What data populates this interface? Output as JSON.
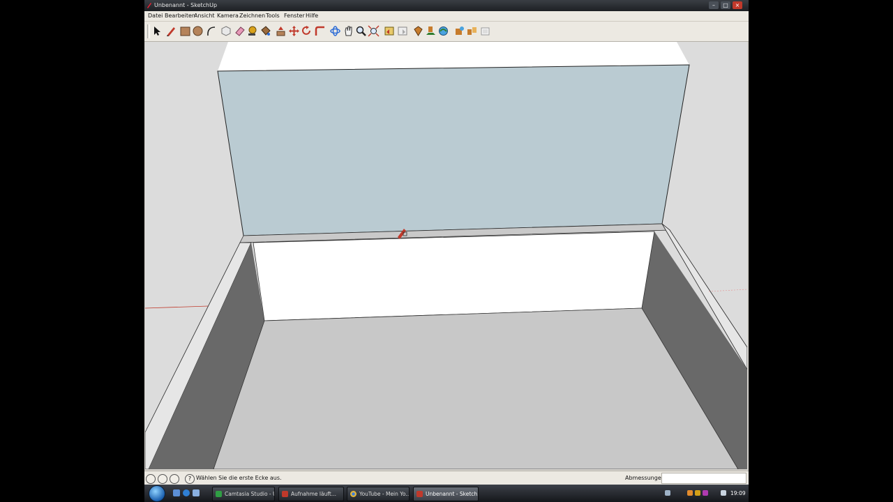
{
  "window": {
    "title": "Unbenannt - SketchUp",
    "controls": [
      "minimize-icon",
      "maximize-icon",
      "close-icon"
    ]
  },
  "menu": [
    "Datei",
    "Bearbeiten",
    "Ansicht",
    "Kamera",
    "Zeichnen",
    "Tools",
    "Fenster",
    "Hilfe"
  ],
  "toolbar": {
    "tools": [
      {
        "name": "select-tool",
        "icon": "arrow-cursor-icon"
      },
      {
        "name": "pencil-tool",
        "icon": "pencil-icon"
      },
      {
        "name": "rectangle-tool",
        "icon": "rectangle-icon"
      },
      {
        "name": "circle-tool",
        "icon": "circle-icon"
      },
      {
        "name": "arc-tool",
        "icon": "arc-icon"
      },
      {
        "name": "make-component-tool",
        "icon": "component-icon"
      },
      {
        "name": "eraser-tool",
        "icon": "eraser-icon"
      },
      {
        "name": "tape-measure-tool",
        "icon": "tape-measure-icon"
      },
      {
        "name": "paint-bucket-tool",
        "icon": "paint-bucket-icon"
      },
      {
        "name": "push-pull-tool",
        "icon": "push-pull-icon"
      },
      {
        "name": "move-tool",
        "icon": "move-icon"
      },
      {
        "name": "rotate-tool",
        "icon": "rotate-icon"
      },
      {
        "name": "follow-me-tool",
        "icon": "follow-me-icon"
      },
      {
        "name": "orbit-tool",
        "icon": "orbit-icon"
      },
      {
        "name": "pan-tool",
        "icon": "pan-hand-icon"
      },
      {
        "name": "zoom-tool",
        "icon": "zoom-icon"
      },
      {
        "name": "zoom-extents-tool",
        "icon": "zoom-extents-icon"
      },
      {
        "name": "previous-view-tool",
        "icon": "previous-view-icon"
      },
      {
        "name": "next-view-tool",
        "icon": "next-view-icon"
      },
      {
        "name": "place-model-tool",
        "icon": "place-model-icon"
      },
      {
        "name": "get-models-tool",
        "icon": "get-models-icon"
      },
      {
        "name": "share-model-tool",
        "icon": "share-model-icon"
      },
      {
        "name": "google-earth-tool",
        "icon": "globe-icon"
      },
      {
        "name": "component-browser-tool",
        "icon": "components-icon"
      },
      {
        "name": "materials-tool",
        "icon": "materials-icon"
      },
      {
        "name": "styles-tool",
        "icon": "styles-icon"
      }
    ]
  },
  "statusbar": {
    "geo_icons": [
      "geo-location-icon",
      "credits-icon",
      "account-icon"
    ],
    "help_icon": "help-icon",
    "message": "Wählen Sie die erste Ecke aus.",
    "measurements_label": "Abmessungen",
    "measurements_value": ""
  },
  "taskbar": {
    "start_icon": "windows-start-icon",
    "quick_launch": [
      "show-desktop-icon",
      "ie-icon",
      "switch-windows-icon"
    ],
    "buttons": [
      {
        "label": "Camtasia Studio - U...",
        "icon": "camtasia-icon",
        "active": false
      },
      {
        "label": "Aufnahme läuft...",
        "icon": "recording-icon",
        "active": false
      },
      {
        "label": "YouTube - Mein Yo...",
        "icon": "chrome-icon",
        "active": false
      },
      {
        "label": "Unbenannt - Sketch...",
        "icon": "sketchup-icon",
        "active": true
      }
    ],
    "tray_icons": [
      "network-icon",
      "tray-app-icon",
      "security-icon",
      "messenger-icon",
      "volume-icon"
    ],
    "clock": "19:09"
  },
  "colors": {
    "wall_face": "#bacbd2",
    "floor": "#c8c8c8",
    "top_surface": "#ffffff",
    "side_wall": "#696969",
    "outer_ground": "#dcdcdc"
  }
}
